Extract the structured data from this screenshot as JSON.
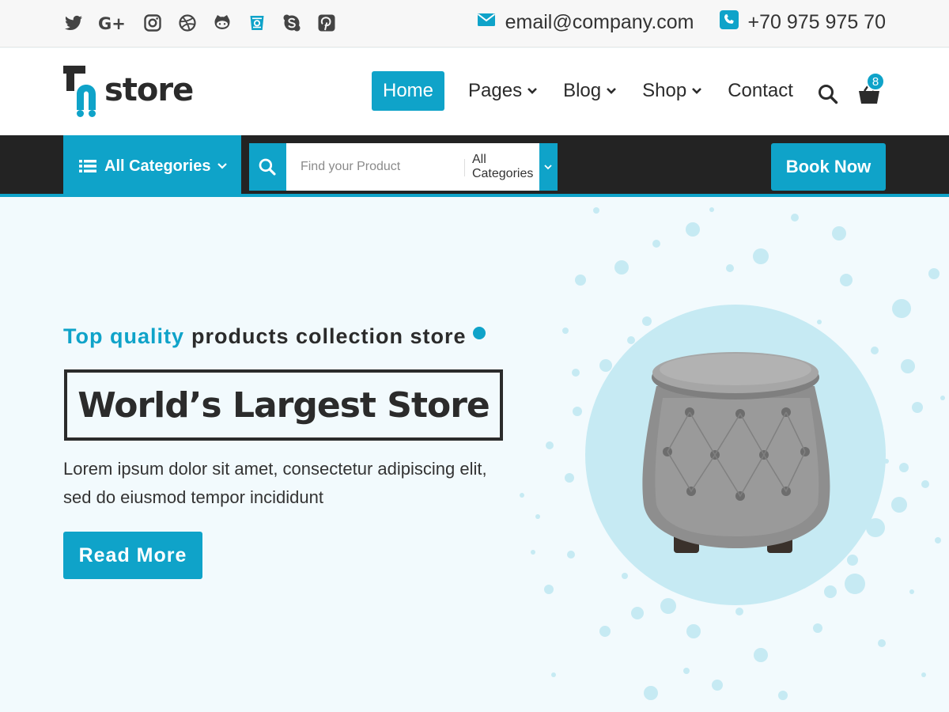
{
  "colors": {
    "accent": "#0fa3c9",
    "dark": "#232323",
    "hero_bg": "#f2fafd",
    "splash": "#c6eaf3"
  },
  "topbar": {
    "social_icons": [
      "twitter-icon",
      "google-plus-icon",
      "instagram-icon",
      "dribbble-icon",
      "github-icon",
      "stack-icon",
      "skype-icon",
      "pinterest-icon"
    ],
    "email": "email@company.com",
    "phone": "+70 975 975 70"
  },
  "header": {
    "logo_text": "store",
    "nav": [
      {
        "label": "Home",
        "active": true
      },
      {
        "label": "Pages",
        "dropdown": true
      },
      {
        "label": "Blog",
        "dropdown": true
      },
      {
        "label": "Shop",
        "dropdown": true
      },
      {
        "label": "Contact"
      }
    ],
    "cart_count": "8"
  },
  "catbar": {
    "all_categories": "All Categories",
    "search_placeholder": "Find your Product",
    "select_value": "All Categories",
    "book_now": "Book Now"
  },
  "hero": {
    "tagline_accent": "Top quality",
    "tagline_rest": "products collection store",
    "headline": "World’s Largest Store",
    "description": "Lorem ipsum dolor sit amet, consectetur adipiscing elit, sed do eiusmod tempor incididunt",
    "cta": "Read More",
    "product_image": "tufted-round-ottoman"
  }
}
